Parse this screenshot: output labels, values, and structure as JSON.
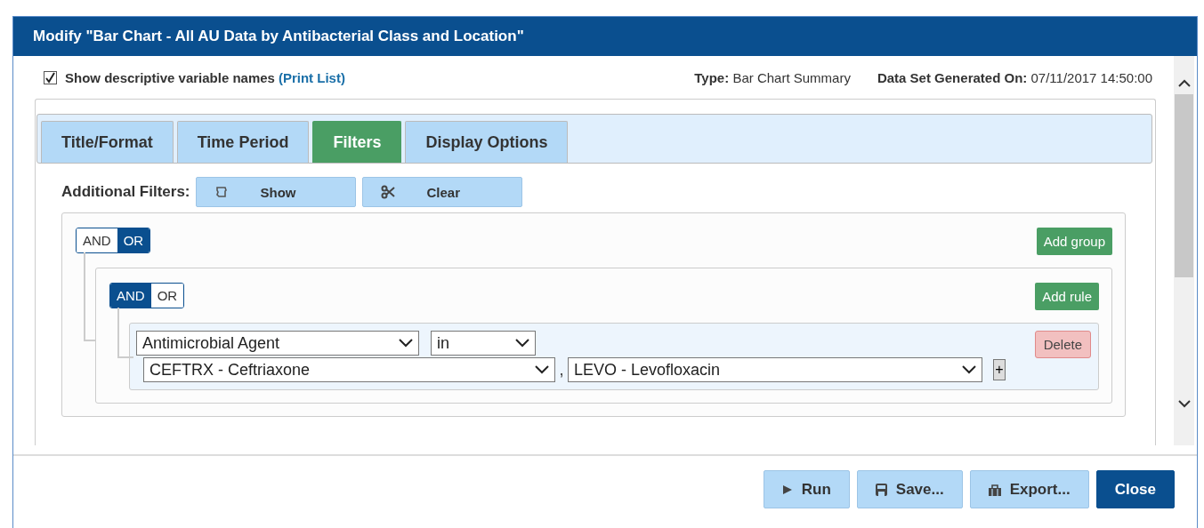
{
  "window": {
    "title": "Modify \"Bar Chart - All AU Data by Antibacterial Class and Location\""
  },
  "options": {
    "label": "Show descriptive variable names",
    "checked": true,
    "link": "(Print List)"
  },
  "info": [
    {
      "label": "Type:",
      "value": "Bar Chart Summary"
    },
    {
      "label": "Data Set Generated On:",
      "value": "07/11/2017 14:50:00"
    }
  ],
  "tabs": [
    {
      "label": "Title/Format",
      "selected": false
    },
    {
      "label": "Time Period",
      "selected": false
    },
    {
      "label": "Filters",
      "selected": true
    },
    {
      "label": "Display Options",
      "selected": false
    }
  ],
  "filters": {
    "label": "Additional Filters:",
    "buttons": [
      {
        "label": "Show"
      },
      {
        "label": "Clear"
      }
    ]
  },
  "group": {
    "conditions": [
      {
        "label": "AND",
        "selected": false
      },
      {
        "label": "OR",
        "selected": true
      }
    ],
    "add_button": "Add group",
    "group": {
      "conditions": [
        {
          "label": "AND",
          "selected": true
        },
        {
          "label": "OR",
          "selected": false
        }
      ],
      "add_button": "Add rule",
      "rule": {
        "field": "Antimicrobial Agent",
        "operator": "in",
        "values": [
          "CEFTRX - Ceftriaxone",
          "LEVO - Levofloxacin"
        ],
        "separator": ",",
        "add_value": "+",
        "delete": "Delete"
      }
    }
  },
  "footer": {
    "buttons": [
      {
        "label": "Run",
        "kind": "secondary"
      },
      {
        "label": "Save...",
        "kind": "secondary"
      },
      {
        "label": "Export...",
        "kind": "secondary"
      },
      {
        "label": "Close",
        "kind": "primary"
      }
    ]
  }
}
